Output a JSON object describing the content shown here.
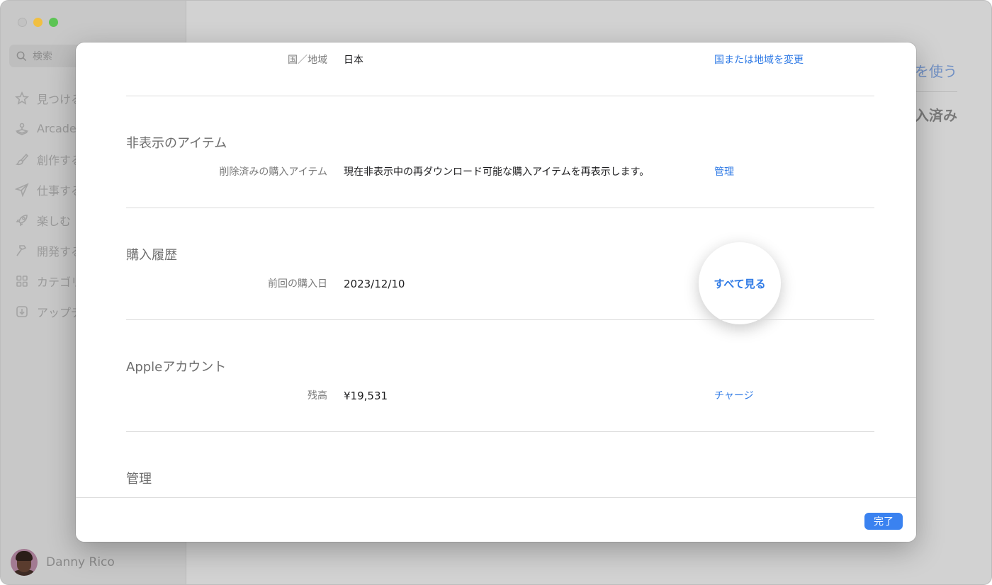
{
  "sidebar": {
    "search_placeholder": "検索",
    "items": [
      {
        "label": "見つける",
        "icon": "star-icon"
      },
      {
        "label": "Arcade",
        "icon": "joystick-icon"
      },
      {
        "label": "創作する",
        "icon": "brush-icon"
      },
      {
        "label": "仕事する",
        "icon": "paperplane-icon"
      },
      {
        "label": "楽しむ",
        "icon": "rocket-icon"
      },
      {
        "label": "開発する",
        "icon": "hammer-icon"
      },
      {
        "label": "カテゴリ",
        "icon": "grid-icon"
      },
      {
        "label": "アップデート",
        "icon": "download-icon"
      }
    ],
    "user_name": "Danny Rico"
  },
  "background": {
    "right_link": "を使う",
    "right_title": "入済み"
  },
  "sheet": {
    "country_row": {
      "label": "国／地域",
      "value": "日本",
      "action": "国または地域を変更"
    },
    "hidden_section": {
      "title": "非表示のアイテム",
      "label": "削除済みの購入アイテム",
      "value": "現在非表示中の再ダウンロード可能な購入アイテムを再表示します。",
      "action": "管理"
    },
    "history_section": {
      "title": "購入履歴",
      "label": "前回の購入日",
      "value": "2023/12/10",
      "action": "すべて見る"
    },
    "account_section": {
      "title": "Appleアカウント",
      "label": "残高",
      "value": "¥19,531",
      "action": "チャージ"
    },
    "manage_section": {
      "title": "管理"
    },
    "done_label": "完了"
  },
  "colors": {
    "accent": "#2f7ae5",
    "done_button": "#3a82f0",
    "traffic_min": "#f1bf41",
    "traffic_max": "#5cc454"
  }
}
